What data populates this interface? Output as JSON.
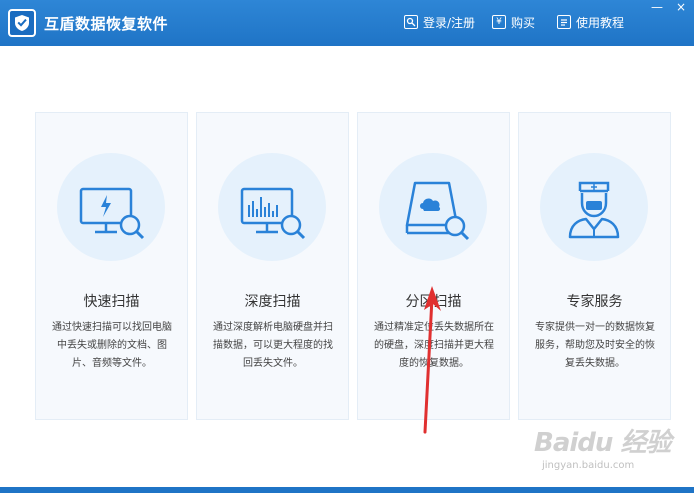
{
  "window": {
    "title": "互盾数据恢复软件",
    "controls": {
      "minimize": "—",
      "close": "×"
    }
  },
  "nav": {
    "login_label": "登录/注册",
    "buy_label": "购买",
    "tutorial_label": "使用教程",
    "buy_icon_glyph": "¥"
  },
  "cards": [
    {
      "title": "快速扫描",
      "desc": "通过快速扫描可以找回电脑中丢失或删除的文档、图片、音频等文件。",
      "icon": "monitor-lightning-search-icon"
    },
    {
      "title": "深度扫描",
      "desc": "通过深度解析电脑硬盘并扫描数据，可以更大程度的找回丢失文件。",
      "icon": "monitor-chart-search-icon"
    },
    {
      "title": "分区扫描",
      "desc": "通过精准定位丢失数据所在的硬盘，深度扫描并更大程度的恢复数据。",
      "icon": "disk-cloud-search-icon"
    },
    {
      "title": "专家服务",
      "desc": "专家提供一对一的数据恢复服务，帮助您及时安全的恢复丢失数据。",
      "icon": "doctor-icon"
    }
  ],
  "colors": {
    "titlebar": "#1f74c6",
    "accent": "#2a82d8",
    "card_bg": "#f6f9fd",
    "icon_circle": "#e5f1fc",
    "annotation": "#e03030"
  },
  "watermark": {
    "main": "Baidu 经验",
    "sub": "jingyan.baidu.com"
  }
}
